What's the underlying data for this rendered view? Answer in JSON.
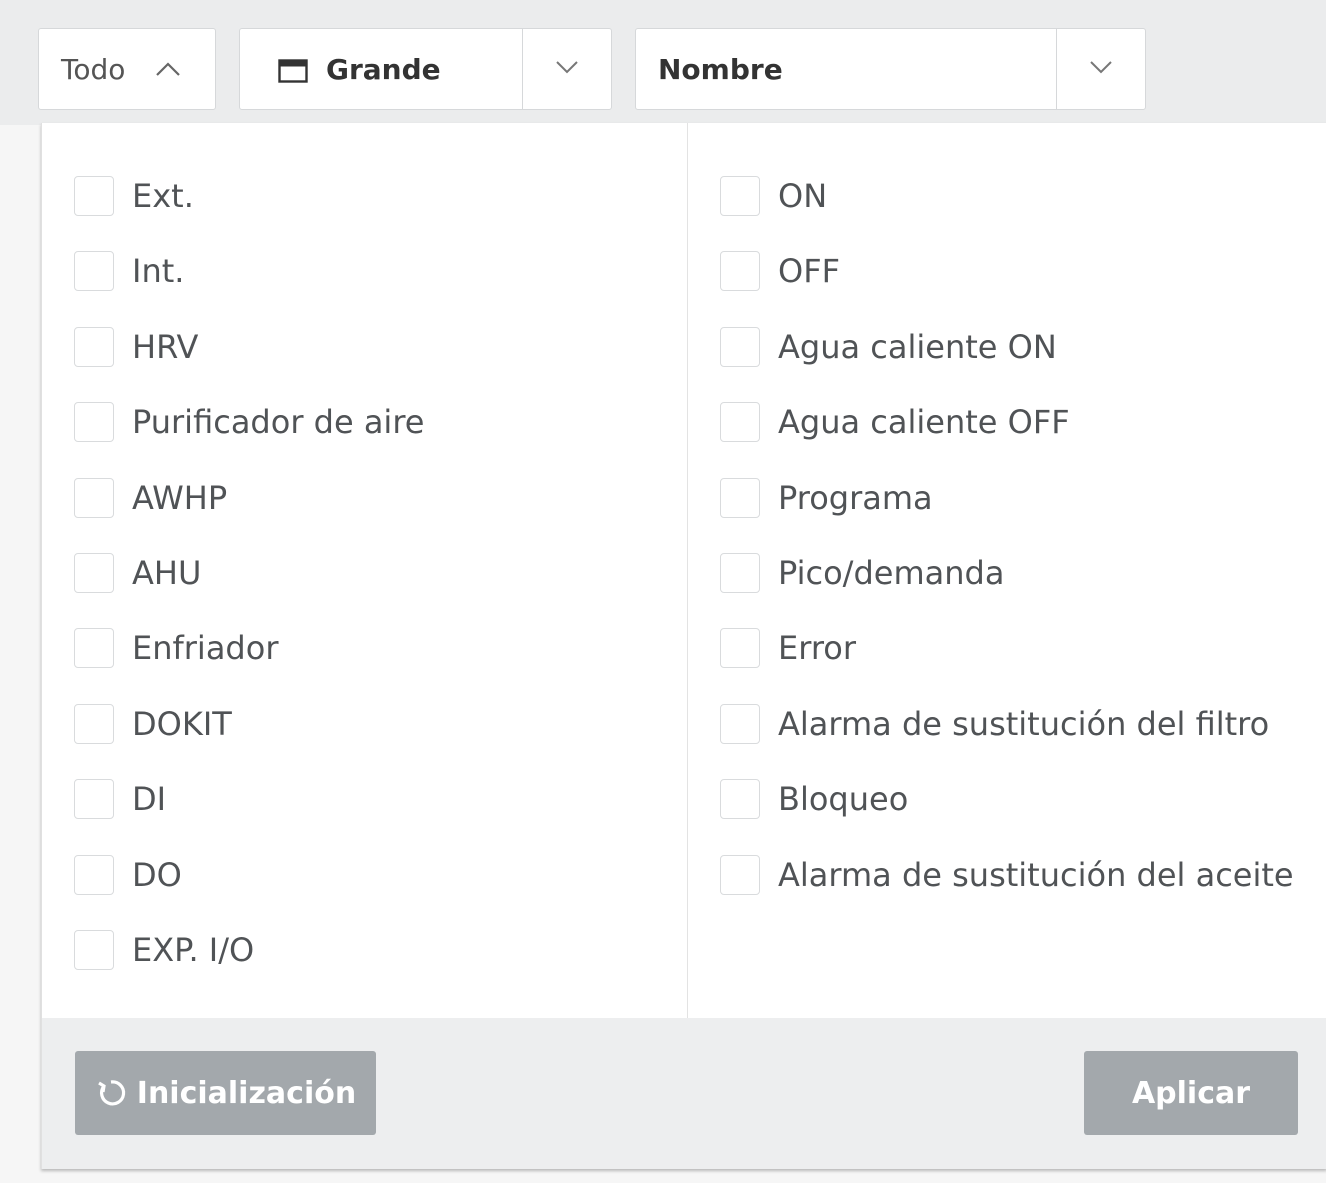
{
  "toolbar": {
    "filter_label": "Todo",
    "view_size": "Grande",
    "sort_by": "Nombre"
  },
  "filter_panel": {
    "device_types": [
      "Ext.",
      "Int.",
      "HRV",
      "Purificador de aire",
      "AWHP",
      "AHU",
      "Enfriador",
      "DOKIT",
      "DI",
      "DO",
      "EXP. I/O"
    ],
    "states": [
      "ON",
      "OFF",
      "Agua caliente ON",
      "Agua caliente OFF",
      "Programa",
      "Pico/demanda",
      "Error",
      "Alarma de sustitución del filtro",
      "Bloqueo",
      "Alarma de sustitución del aceite"
    ],
    "reset_label": "Inicialización",
    "apply_label": "Aplicar"
  },
  "colors": {
    "button_disabled": "#a3a8ac",
    "panel_footer": "#edeeef",
    "checkbox_border": "#d9dbdd"
  }
}
